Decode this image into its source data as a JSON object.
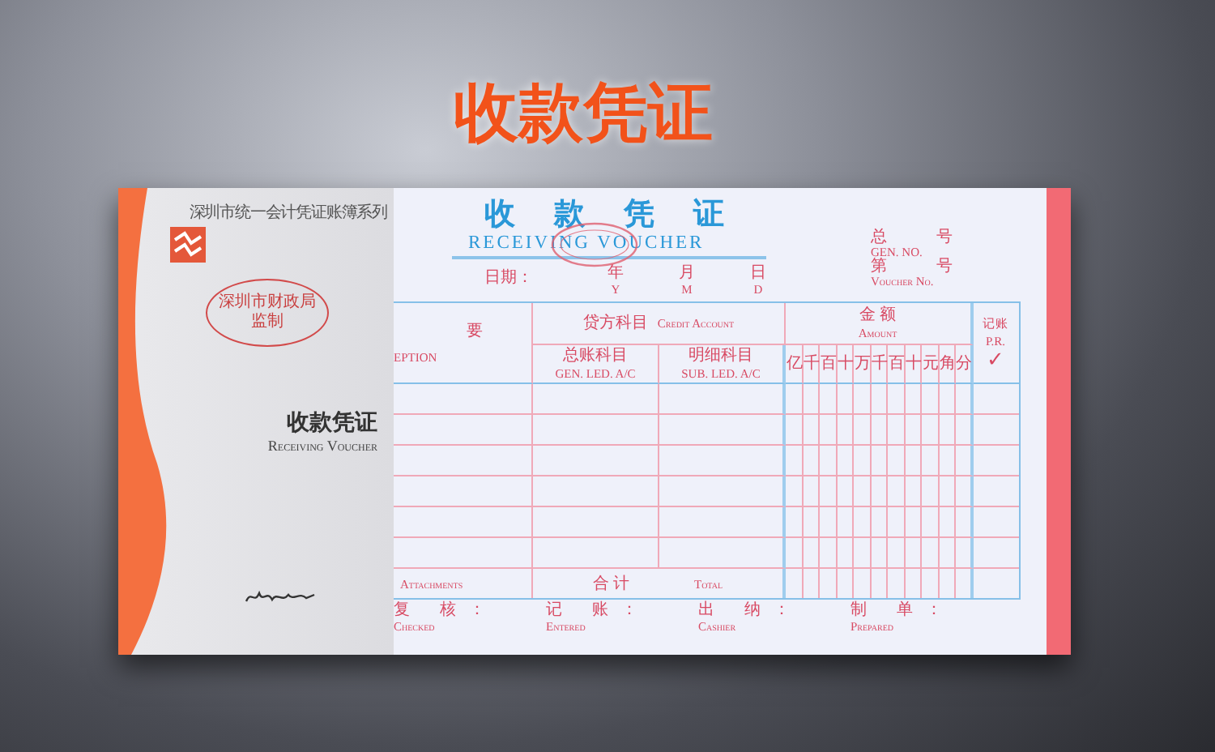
{
  "heading": "收款凭证",
  "cover": {
    "series": "深圳市统一会计凭证账簿系列",
    "stamp": [
      "深圳市财政局",
      "监制"
    ],
    "title": "收款凭证",
    "subtitle": "Receiving Voucher"
  },
  "form": {
    "title": "收款凭证",
    "subtitle": "RECEIVING VOUCHER",
    "date": {
      "label": "日期：",
      "parts": [
        {
          "zh": "年",
          "en": "Y"
        },
        {
          "zh": "月",
          "en": "M"
        },
        {
          "zh": "日",
          "en": "D"
        }
      ]
    },
    "numbers": [
      {
        "zh": "总 号",
        "en": "GEN. NO."
      },
      {
        "zh": "第 号",
        "en": "Voucher No."
      }
    ],
    "table": {
      "description": {
        "zh": "要",
        "en": "EPTION"
      },
      "credit": {
        "zh": "贷方科目",
        "en": "Credit Account"
      },
      "general": {
        "zh": "总账科目",
        "en": "GEN. LED. A/C"
      },
      "sub": {
        "zh": "明细科目",
        "en": "SUB. LED. A/C"
      },
      "amount": {
        "zh": "金 额",
        "en": "Amount"
      },
      "digits": [
        "亿",
        "千",
        "百",
        "十",
        "万",
        "千",
        "百",
        "十",
        "元",
        "角",
        "分"
      ],
      "posted": {
        "zh": "记账",
        "en": "P.R.",
        "check": "✓"
      },
      "attachments": "Attachments",
      "total": {
        "zh": "合 计",
        "en": "Total"
      }
    },
    "signatures": [
      {
        "zh": "复 核：",
        "en": "Checked"
      },
      {
        "zh": "记 账：",
        "en": "Entered"
      },
      {
        "zh": "出 纳：",
        "en": "Cashier"
      },
      {
        "zh": "制 单：",
        "en": "Prepared"
      }
    ]
  }
}
